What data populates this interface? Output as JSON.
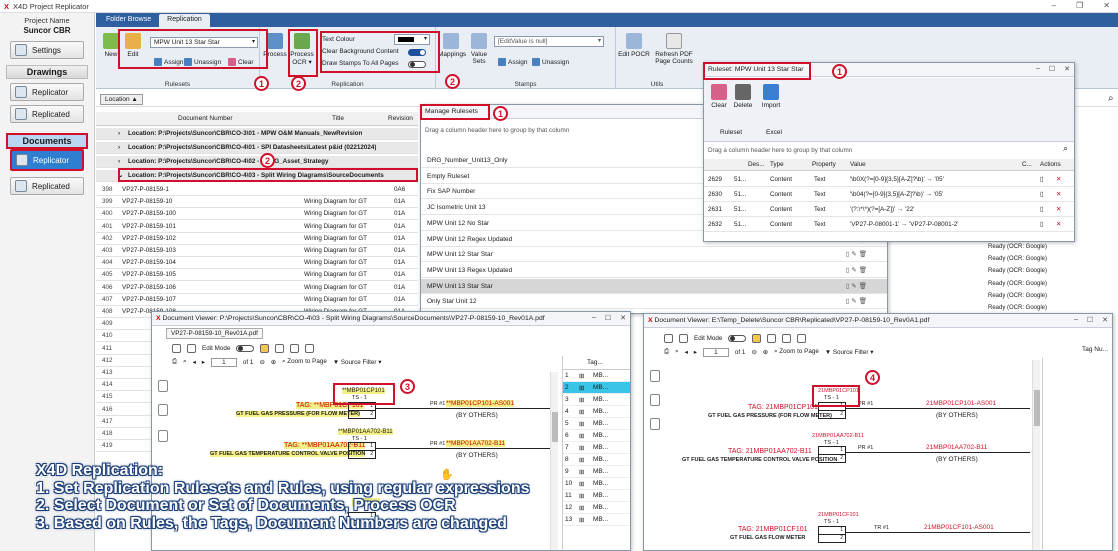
{
  "window": {
    "title": "X4D Project Replicator"
  },
  "left": {
    "project_label": "Project Name",
    "project_name": "Suncor CBR",
    "settings": "Settings",
    "drawings_header": "Drawings",
    "drawings_replicator": "Replicator",
    "drawings_replicated": "Replicated",
    "documents_header": "Documents",
    "documents_replicator": "Replicator",
    "documents_replicated": "Replicated"
  },
  "tabs": [
    "Folder Browse",
    "Replication"
  ],
  "ribbon": {
    "new": "New",
    "edit": "Edit",
    "ruleset_combo": "MPW Unit 13 Star Star",
    "assign": "Assign",
    "unassign": "Unassign",
    "clear": "Clear",
    "rulesets_label": "Rulesets",
    "process": "Process",
    "process_ocr_1": "Process",
    "process_ocr_2": "OCR",
    "text_colour": "Text Colour",
    "clear_bg": "Clear Background Content",
    "draw_stamps": "Draw Stamps To All Pages",
    "replication_label": "Replication",
    "mappings": "Mappings",
    "value_sets_1": "Value",
    "value_sets_2": "Sets",
    "edit_value_combo": "[EditValue is null]",
    "assign2": "Assign",
    "unassign2": "Unassign",
    "stamps_label": "Stamps",
    "edit_pocr": "Edit POCR",
    "refresh_pdf_1": "Refresh PDF",
    "refresh_pdf_2": "Page Counts",
    "utils_label": "Utils"
  },
  "location_chip": "Location",
  "grid": {
    "headers": [
      "Document Number",
      "Title",
      "Revision"
    ],
    "groups": [
      "Location: P:\\Projects\\Suncor\\CBR\\CO-3\\01 - MPW O&M Manuals_NewRevision",
      "Location: P:\\Projects\\Suncor\\CBR\\CO-4\\01 - SPI Datasheets\\Latest p&id (02212024)",
      "Location: P:\\Projects\\Suncor\\CBR\\CO-4\\02 - HRSG_Asset_Strategy",
      "Location: P:\\Projects\\Suncor\\CBR\\CO-4\\03 - Split Wiring Diagrams\\SourceDocuments"
    ],
    "rows": [
      {
        "n": "398",
        "doc": "VP27-P-08159-1",
        "title": "",
        "rev": "0A6"
      },
      {
        "n": "399",
        "doc": "VP27-P-08159-10",
        "title": "Wiring Diagram for GT",
        "rev": "01A"
      },
      {
        "n": "400",
        "doc": "VP27-P-08159-100",
        "title": "Wiring Diagram for GT",
        "rev": "01A"
      },
      {
        "n": "401",
        "doc": "VP27-P-08159-101",
        "title": "Wiring Diagram for GT",
        "rev": "01A"
      },
      {
        "n": "402",
        "doc": "VP27-P-08159-102",
        "title": "Wiring Diagram for GT",
        "rev": "01A"
      },
      {
        "n": "403",
        "doc": "VP27-P-08159-103",
        "title": "Wiring Diagram for GT",
        "rev": "01A"
      },
      {
        "n": "404",
        "doc": "VP27-P-08159-104",
        "title": "Wiring Diagram for GT",
        "rev": "01A"
      },
      {
        "n": "405",
        "doc": "VP27-P-08159-105",
        "title": "Wiring Diagram for GT",
        "rev": "01A"
      },
      {
        "n": "406",
        "doc": "VP27-P-08159-106",
        "title": "Wiring Diagram for GT",
        "rev": "01A"
      },
      {
        "n": "407",
        "doc": "VP27-P-08159-107",
        "title": "Wiring Diagram for GT",
        "rev": "01A"
      },
      {
        "n": "408",
        "doc": "VP27-P-08159-108",
        "title": "Wiring Diagram for GT",
        "rev": "01A"
      },
      {
        "n": "409",
        "doc": "",
        "title": "",
        "rev": ""
      },
      {
        "n": "410",
        "doc": "",
        "title": "",
        "rev": ""
      },
      {
        "n": "411",
        "doc": "",
        "title": "",
        "rev": ""
      },
      {
        "n": "412",
        "doc": "",
        "title": "",
        "rev": ""
      },
      {
        "n": "413",
        "doc": "",
        "title": "",
        "rev": ""
      },
      {
        "n": "414",
        "doc": "",
        "title": "",
        "rev": ""
      },
      {
        "n": "415",
        "doc": "",
        "title": "",
        "rev": ""
      },
      {
        "n": "416",
        "doc": "",
        "title": "",
        "rev": ""
      },
      {
        "n": "417",
        "doc": "",
        "title": "",
        "rev": ""
      },
      {
        "n": "418",
        "doc": "",
        "title": "",
        "rev": ""
      },
      {
        "n": "419",
        "doc": "",
        "title": "",
        "rev": ""
      }
    ],
    "status_rows": [
      "Ready (OCR: Google)",
      "Ready (OCR: Google)",
      "Ready (OCR: Google)",
      "Ready (OCR: Google)",
      "Ready (OCR: Google)",
      "Ready (OCR: Google)"
    ]
  },
  "manage": {
    "title": "Manage Rulesets",
    "drag_hint": "Drag a column header here to group by that column",
    "items": [
      "DRG_Number_Unit13_Only",
      "Empty Ruleset",
      "Fix SAP Number",
      "JC Isometric Unit 13",
      "MPW Unit 12 No Star",
      "MPW Unit 12 Regex Updated",
      "MPW Unit 12 Star Star",
      "MPW Unit 13 Regex Updated",
      "MPW Unit 13 Star Star",
      "Only Star Unit 12"
    ]
  },
  "ruleset": {
    "title": "Ruleset: MPW Unit 13 Star Star",
    "clear": "Clear",
    "delete": "Delete",
    "import": "Import",
    "group_ruleset": "Ruleset",
    "group_excel": "Excel",
    "drag_hint": "Drag a column header here to group by that column",
    "headers": [
      "Des...",
      "Type",
      "Property",
      "Value",
      "C...",
      "Actions"
    ],
    "rows": [
      {
        "id": "2629",
        "des": "51...",
        "type": "Content",
        "prop": "Text",
        "value": "'\\b0X(?=[0-9]{3,5}[A-Z]?\\b)' → '05'"
      },
      {
        "id": "2630",
        "des": "51...",
        "type": "Content",
        "prop": "Text",
        "value": "'\\b04(?=[0-9]{3,5}[A-Z]?\\b)' → '05'"
      },
      {
        "id": "2631",
        "des": "51...",
        "type": "Content",
        "prop": "Text",
        "value": "'(?:\\*\\*)(?=[A-Z])' → '22'"
      },
      {
        "id": "2632",
        "des": "51...",
        "type": "Content",
        "prop": "Text",
        "value": "'VP27-P-08001-1' → 'VP27-P-08001-2'"
      }
    ]
  },
  "viewer1": {
    "title": "Document Viewer: P:\\Projects\\Suncor\\CBR\\CO-4\\03 - Split Wiring Diagrams\\SourceDocuments\\VP27-P-08159-10_Rev01A.pdf",
    "tab": "VP27-P-08159-10_Rev01A.pdf",
    "edit_mode": "Edit Mode",
    "page": "1",
    "of": "of 1",
    "zoom": "Zoom to Page",
    "source_filter": "Source Filter",
    "tag_header": "Tag...",
    "tag1": "TAG: **MBP01CP101",
    "tag1_desc": "GT FUEL GAS PRESSURE (FOR FLOW METER)",
    "tag1_box": "**MBP01CP101",
    "ts": "TS - 1",
    "pr": "PR #1",
    "tag1_right": "**MBP01CP101-AS001",
    "by_others": "(BY OTHERS)",
    "tag2": "TAG: **MBP01AA702-B11",
    "tag2_desc": "GT FUEL GAS TEMPERATURE CONTROL VALVE POSITION",
    "tag2_box": "**MBP01AA702-B11",
    "tag2_right": "**MBP01AA702-B11",
    "tags": [
      {
        "n": "1",
        "v": "MB..."
      },
      {
        "n": "2",
        "v": "MB..."
      },
      {
        "n": "3",
        "v": "MB..."
      },
      {
        "n": "4",
        "v": "MB..."
      },
      {
        "n": "5",
        "v": "MB..."
      },
      {
        "n": "6",
        "v": "MB..."
      },
      {
        "n": "7",
        "v": "MB..."
      },
      {
        "n": "8",
        "v": "MB..."
      },
      {
        "n": "9",
        "v": "MB..."
      },
      {
        "n": "10",
        "v": "MB..."
      },
      {
        "n": "11",
        "v": "MB..."
      },
      {
        "n": "12",
        "v": "MB..."
      },
      {
        "n": "13",
        "v": "MB..."
      }
    ]
  },
  "viewer2": {
    "title": "Document Viewer: E:\\Temp_Delete\\Suncor CBR\\Replicated\\VP27-P-08159-10_Rev0A1.pdf",
    "edit_mode": "Edit Mode",
    "page": "1",
    "of": "of 1",
    "zoom": "Zoom to Page",
    "source_filter": "Source Filter",
    "tag_header": "Tag Nu...",
    "tag1": "TAG: 21MBP01CP101",
    "tag1_desc": "GT FUEL GAS PRESSURE (FOR FLOW METER)",
    "tag1_box": "21MBP01CP101",
    "ts": "TS - 1",
    "pr": "PR #1",
    "tag1_right": "21MBP01CP101-AS001",
    "by_others": "(BY OTHERS)",
    "tag2": "TAG: 21MBP01AA702-B11",
    "tag2_desc": "GT FUEL GAS TEMPERATURE CONTROL VALVE POSITION",
    "tag2_box": "21MBP01AA702-B11",
    "tag2_right": "21MBP01AA702-B11",
    "tag3": "TAG: 21MBP01CF101",
    "tag3_desc": "GT FUEL GAS FLOW METER",
    "tag3_box": "21MBP01CF101",
    "tr": "TR #1",
    "tag3_right": "21MBP01CF101-AS001"
  },
  "badges": [
    "1",
    "2",
    "2",
    "1",
    "2",
    "1",
    "3",
    "4"
  ],
  "caption": {
    "line0": "X4D Replication:",
    "line1": "1. Set Replication Rulesets and Rules, using regular expressions",
    "line2": "2. Select Document or Set of Documents, Process OCR",
    "line3": "3. Based on Rules, the Tags, Document Numbers are changed"
  },
  "colors": {
    "accent": "#2f5f9e",
    "annotation": "#d0102a",
    "highlight": "#f5f086",
    "replaced": "#d0102a"
  }
}
